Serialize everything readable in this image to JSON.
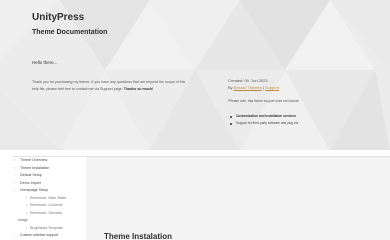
{
  "header": {
    "brand": "UnityPress",
    "subtitle": "Theme Documentation",
    "hello": "Hello there...",
    "thanks_text": "Thank you for purchasing my theme. If you have any questions that are beyond the scope of this help file, please feel free to contact me via Support page.",
    "thanks_bold": "Thanks so much!"
  },
  "meta": {
    "created": "Created: 09. Jun 2023",
    "by_label": "By",
    "author_link": "Besnut Themes",
    "separator": "|",
    "support_link": "Support",
    "note": "*Please note, that theme support does not include:",
    "bullets": [
      "Customization and installation services",
      "Support for third-party software and plug-ins"
    ]
  },
  "nav": [
    {
      "label": "Theme Overview",
      "level": 0
    },
    {
      "label": "Theme Installation",
      "level": 0
    },
    {
      "label": "Default Setup",
      "level": 0
    },
    {
      "label": "Demo Import",
      "level": 0
    },
    {
      "label": "Homepage Setup",
      "level": 0
    },
    {
      "label": "Elementor: Main Slider",
      "level": 2
    },
    {
      "label": "Elementor: Columns",
      "level": 2
    },
    {
      "label": "Elementor: Services",
      "level": 2
    },
    {
      "label": "Image",
      "level": 1
    },
    {
      "label": "Blog/News Template",
      "level": 2
    },
    {
      "label": "Custom sidebar support",
      "level": 0
    }
  ],
  "main": {
    "section_title": "Theme Instalation"
  },
  "colors": {
    "header_bg": "#ededed",
    "link": "#c08a3e",
    "content_bg": "#f4f4f4"
  }
}
